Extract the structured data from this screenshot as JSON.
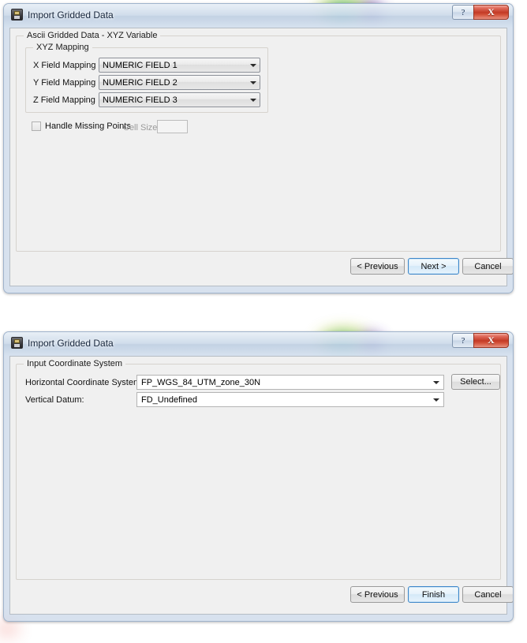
{
  "dialogs": [
    {
      "id": "xyz-variable",
      "title": "Import Gridded Data",
      "caption": {
        "help_label": "?",
        "close_label": "X"
      },
      "outer_group": "Ascii Gridded Data - XYZ Variable",
      "inner_group": "XYZ Mapping",
      "mappings": [
        {
          "label": "X Field Mapping",
          "value": "NUMERIC FIELD 1"
        },
        {
          "label": "Y Field Mapping",
          "value": "NUMERIC FIELD 2"
        },
        {
          "label": "Z Field Mapping",
          "value": "NUMERIC FIELD 3"
        }
      ],
      "missing_points": {
        "checkbox_label": "Handle Missing Points",
        "checked": false,
        "cell_size_label": "Cell Size:",
        "cell_size_value": ""
      },
      "buttons": {
        "previous": "< Previous",
        "next": "Next >",
        "cancel": "Cancel"
      }
    },
    {
      "id": "coordinate-system",
      "title": "Import Gridded Data",
      "caption": {
        "help_label": "?",
        "close_label": "X"
      },
      "outer_group": "Input Coordinate System",
      "fields": [
        {
          "label": "Horizontal Coordinate System:",
          "value": "FP_WGS_84_UTM_zone_30N"
        },
        {
          "label": "Vertical Datum:",
          "value": "FD_Undefined"
        }
      ],
      "select_button": "Select...",
      "buttons": {
        "previous": "< Previous",
        "finish": "Finish",
        "cancel": "Cancel"
      }
    }
  ],
  "colors": {
    "close_button": "#c33a26",
    "default_button_border": "#3c86c9",
    "client_background": "#f0f0f0",
    "glass_frame": "#c8d6e7"
  }
}
